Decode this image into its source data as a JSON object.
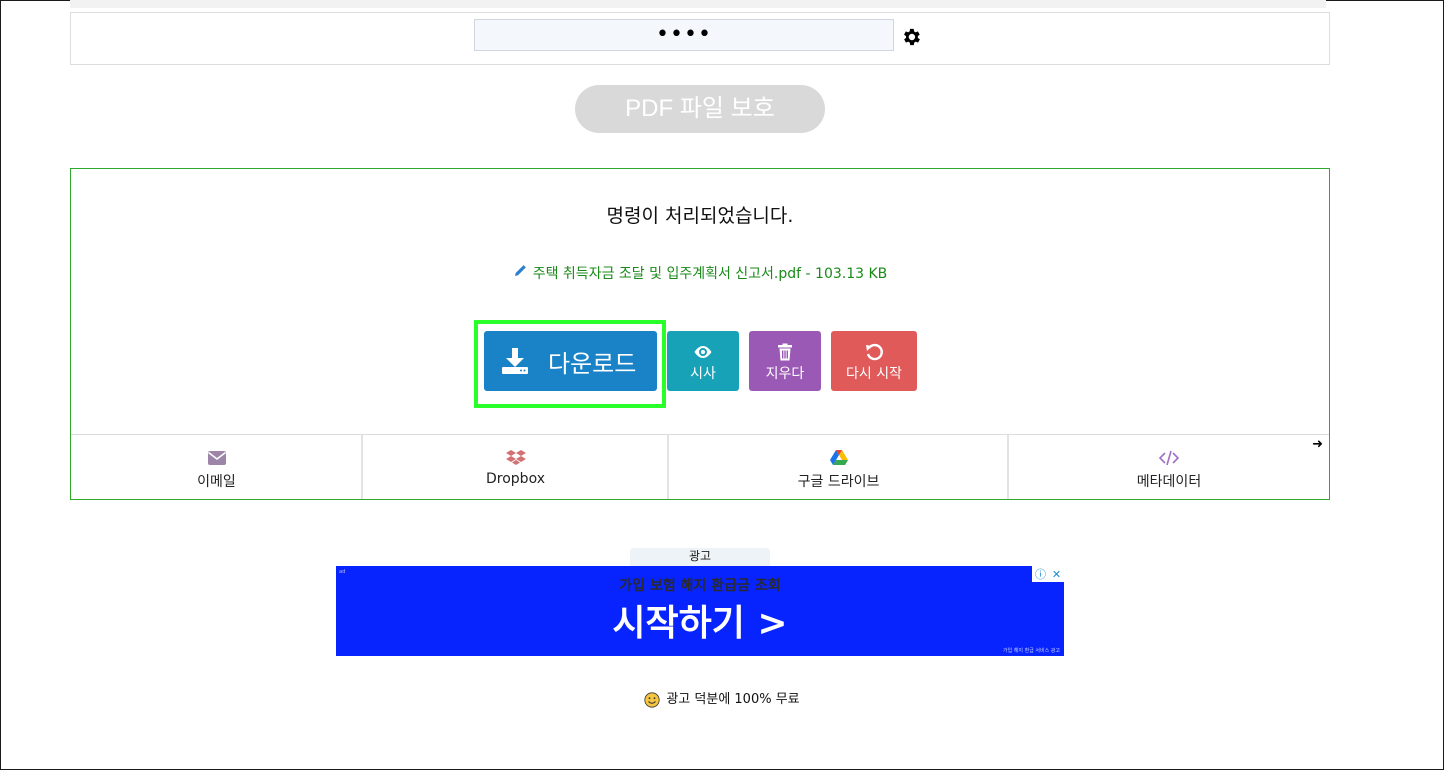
{
  "password": {
    "masked_value": "••••"
  },
  "protect_button": {
    "label": "PDF 파일 보호"
  },
  "result": {
    "message": "명령이 처리되었습니다.",
    "file_label": "주택 취득자금 조달 및 입주계획서 신고서.pdf - 103.13 KB"
  },
  "actions": {
    "download": "다운로드",
    "preview": "시사",
    "delete": "지우다",
    "restart": "다시 시작"
  },
  "share": {
    "email": "이메일",
    "dropbox": "Dropbox",
    "gdrive": "구글 드라이브",
    "metadata": "메타데이터"
  },
  "ad": {
    "label": "광고",
    "top_text": "가입 보험 해지 환급금 조회",
    "main_text": "시작하기 >",
    "footnote": "가입 해지 환급 서비스 광고"
  },
  "footer": {
    "free_text": "광고 덕분에 100% 무료"
  },
  "colors": {
    "download": "#1a82c6",
    "preview": "#17a2b8",
    "delete": "#9b59b6",
    "restart": "#e05a5a",
    "highlight": "#2aff2a",
    "result_border": "#2ea82e",
    "ad_bg": "#0724ff"
  }
}
